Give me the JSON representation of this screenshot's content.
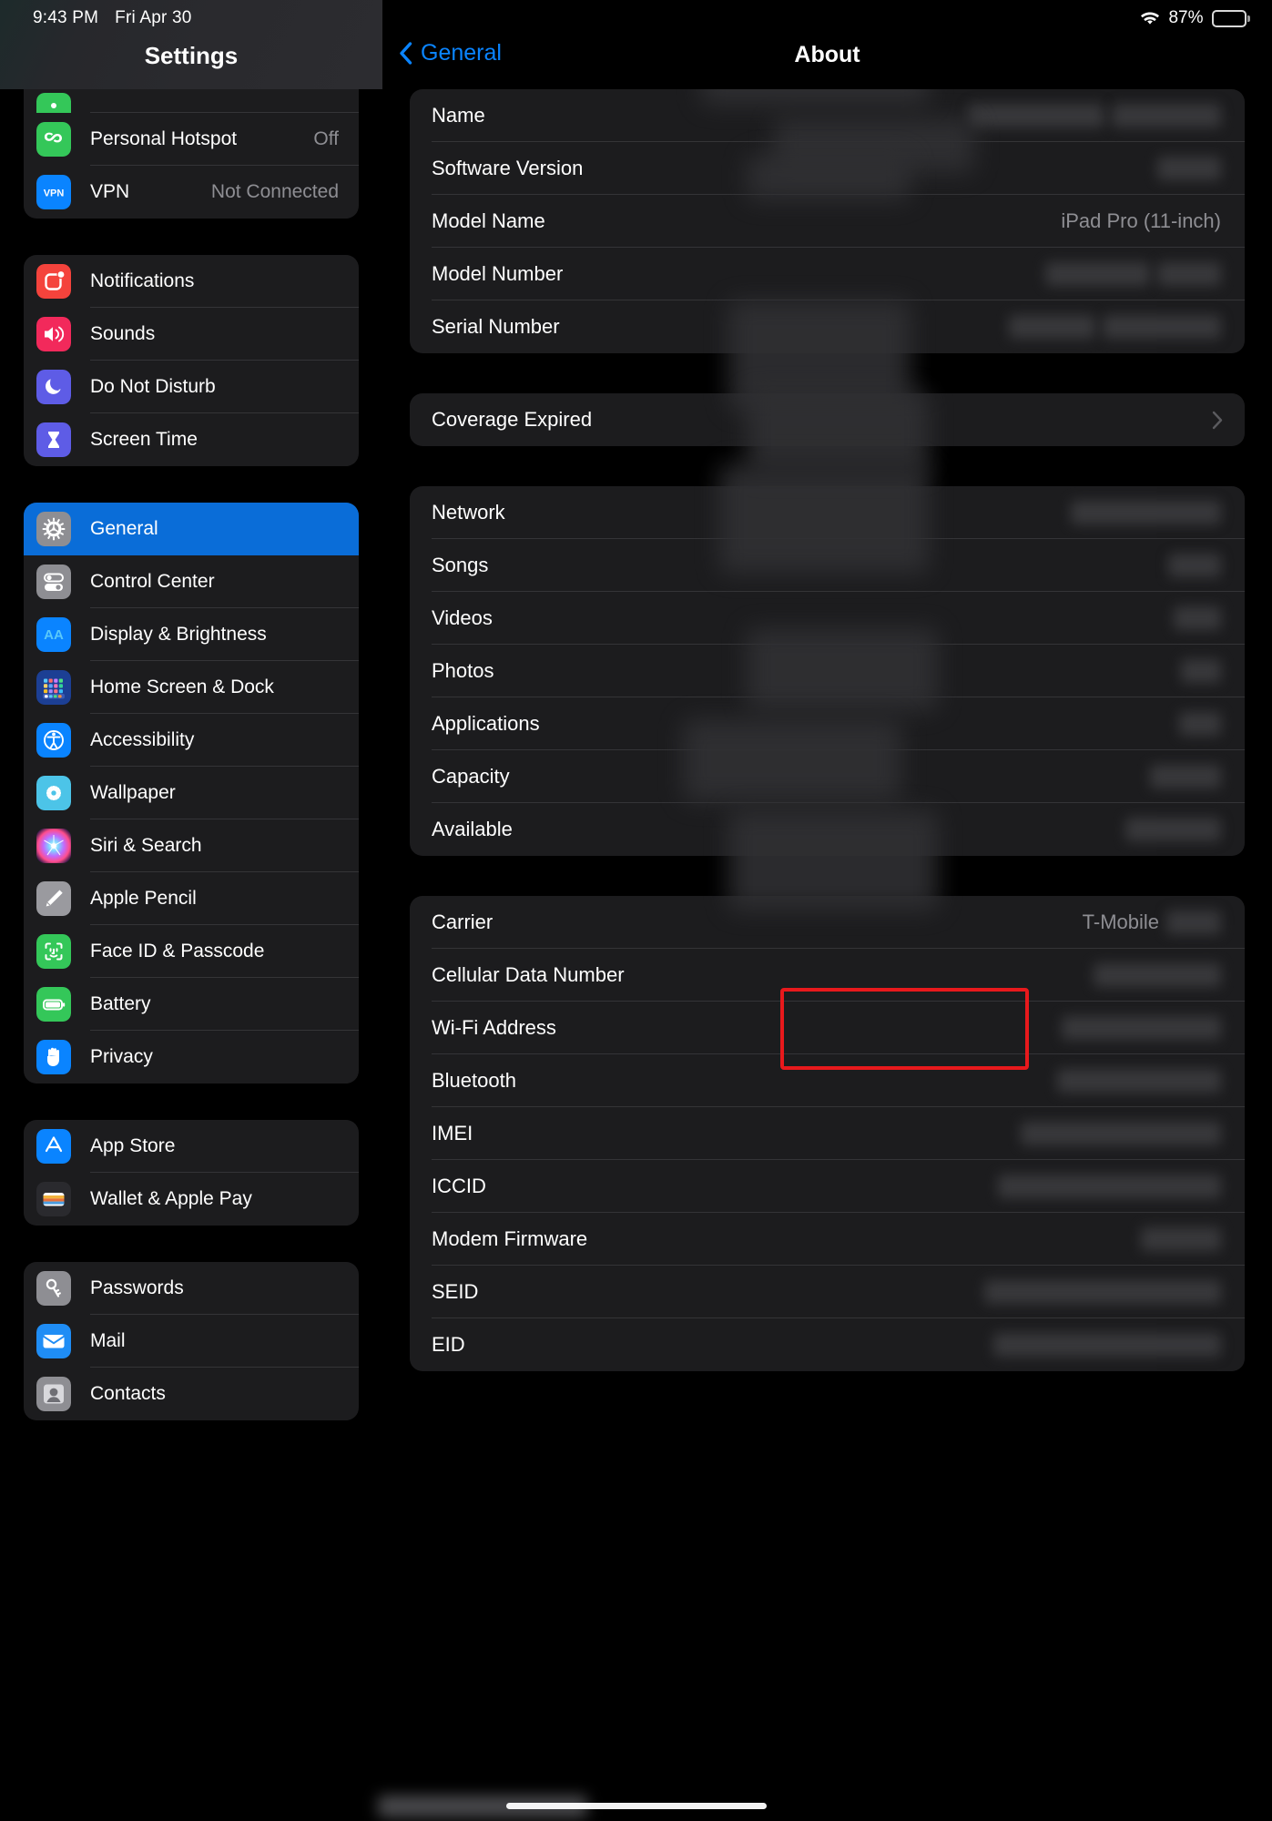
{
  "status_bar": {
    "time": "9:43 PM",
    "date": "Fri Apr 30",
    "battery_percent": "87%",
    "wifi_icon": "wifi-icon",
    "battery_icon": "battery-icon",
    "battery_level": 87
  },
  "sidebar": {
    "title": "Settings",
    "groups": [
      {
        "name": "connectivity",
        "items": [
          {
            "label": "",
            "value": "",
            "icon": "hotspot-partial-icon",
            "partial": true
          },
          {
            "label": "Personal Hotspot",
            "value": "Off",
            "icon": "hotspot-icon"
          },
          {
            "label": "VPN",
            "value": "Not Connected",
            "icon": "vpn-icon"
          }
        ]
      },
      {
        "name": "alerts",
        "items": [
          {
            "label": "Notifications",
            "value": "",
            "icon": "notifications-icon"
          },
          {
            "label": "Sounds",
            "value": "",
            "icon": "sounds-icon"
          },
          {
            "label": "Do Not Disturb",
            "value": "",
            "icon": "do-not-disturb-icon"
          },
          {
            "label": "Screen Time",
            "value": "",
            "icon": "screen-time-icon"
          }
        ]
      },
      {
        "name": "system",
        "items": [
          {
            "label": "General",
            "value": "",
            "icon": "gear-icon",
            "selected": true
          },
          {
            "label": "Control Center",
            "value": "",
            "icon": "control-center-icon"
          },
          {
            "label": "Display & Brightness",
            "value": "",
            "icon": "display-brightness-icon"
          },
          {
            "label": "Home Screen & Dock",
            "value": "",
            "icon": "home-screen-dock-icon"
          },
          {
            "label": "Accessibility",
            "value": "",
            "icon": "accessibility-icon"
          },
          {
            "label": "Wallpaper",
            "value": "",
            "icon": "wallpaper-icon"
          },
          {
            "label": "Siri & Search",
            "value": "",
            "icon": "siri-search-icon"
          },
          {
            "label": "Apple Pencil",
            "value": "",
            "icon": "apple-pencil-icon"
          },
          {
            "label": "Face ID & Passcode",
            "value": "",
            "icon": "face-id-icon"
          },
          {
            "label": "Battery",
            "value": "",
            "icon": "battery-settings-icon"
          },
          {
            "label": "Privacy",
            "value": "",
            "icon": "privacy-icon"
          }
        ]
      },
      {
        "name": "store",
        "items": [
          {
            "label": "App Store",
            "value": "",
            "icon": "app-store-icon"
          },
          {
            "label": "Wallet & Apple Pay",
            "value": "",
            "icon": "wallet-icon"
          }
        ]
      },
      {
        "name": "accounts",
        "items": [
          {
            "label": "Passwords",
            "value": "",
            "icon": "passwords-icon"
          },
          {
            "label": "Mail",
            "value": "",
            "icon": "mail-icon"
          },
          {
            "label": "Contacts",
            "value": "",
            "icon": "contacts-icon"
          }
        ]
      }
    ]
  },
  "detail": {
    "back_label": "General",
    "title": "About",
    "groups": [
      {
        "name": "device-info",
        "rows": [
          {
            "label": "Name",
            "value": "",
            "redacted": true
          },
          {
            "label": "Software Version",
            "value": "",
            "redacted": true
          },
          {
            "label": "Model Name",
            "value": "iPad Pro (11-inch)",
            "redacted": false
          },
          {
            "label": "Model Number",
            "value": "",
            "redacted": true
          },
          {
            "label": "Serial Number",
            "value": "",
            "redacted": true
          }
        ]
      },
      {
        "name": "coverage",
        "rows": [
          {
            "label": "Coverage Expired",
            "value": "",
            "chevron": true
          }
        ]
      },
      {
        "name": "storage-media",
        "rows": [
          {
            "label": "Network",
            "value": "",
            "redacted": true
          },
          {
            "label": "Songs",
            "value": "",
            "redacted": true
          },
          {
            "label": "Videos",
            "value": "",
            "redacted": true
          },
          {
            "label": "Photos",
            "value": "",
            "redacted": true
          },
          {
            "label": "Applications",
            "value": "",
            "redacted": true
          },
          {
            "label": "Capacity",
            "value": "",
            "redacted": true
          },
          {
            "label": "Available",
            "value": "",
            "redacted": true
          }
        ]
      },
      {
        "name": "cellular-identifiers",
        "rows": [
          {
            "label": "Carrier",
            "value": "T-Mobile",
            "redacted": true
          },
          {
            "label": "Cellular Data Number",
            "value": "",
            "redacted": true,
            "highlighted": true
          },
          {
            "label": "Wi-Fi Address",
            "value": "",
            "redacted": true
          },
          {
            "label": "Bluetooth",
            "value": "",
            "redacted": true
          },
          {
            "label": "IMEI",
            "value": "",
            "redacted": true
          },
          {
            "label": "ICCID",
            "value": "",
            "redacted": true
          },
          {
            "label": "Modem Firmware",
            "value": "",
            "redacted": true
          },
          {
            "label": "SEID",
            "value": "",
            "redacted": true
          },
          {
            "label": "EID",
            "value": "",
            "redacted": true
          }
        ]
      }
    ]
  },
  "annotation": {
    "color": "#e8191c",
    "target_label": "Cellular Data Number"
  },
  "colors": {
    "accent_blue": "#0a84ff",
    "selected_row": "#0a6dd8",
    "group_bg": "#1c1c1e",
    "page_bg": "#000000",
    "secondary_text": "#8e8e93"
  }
}
